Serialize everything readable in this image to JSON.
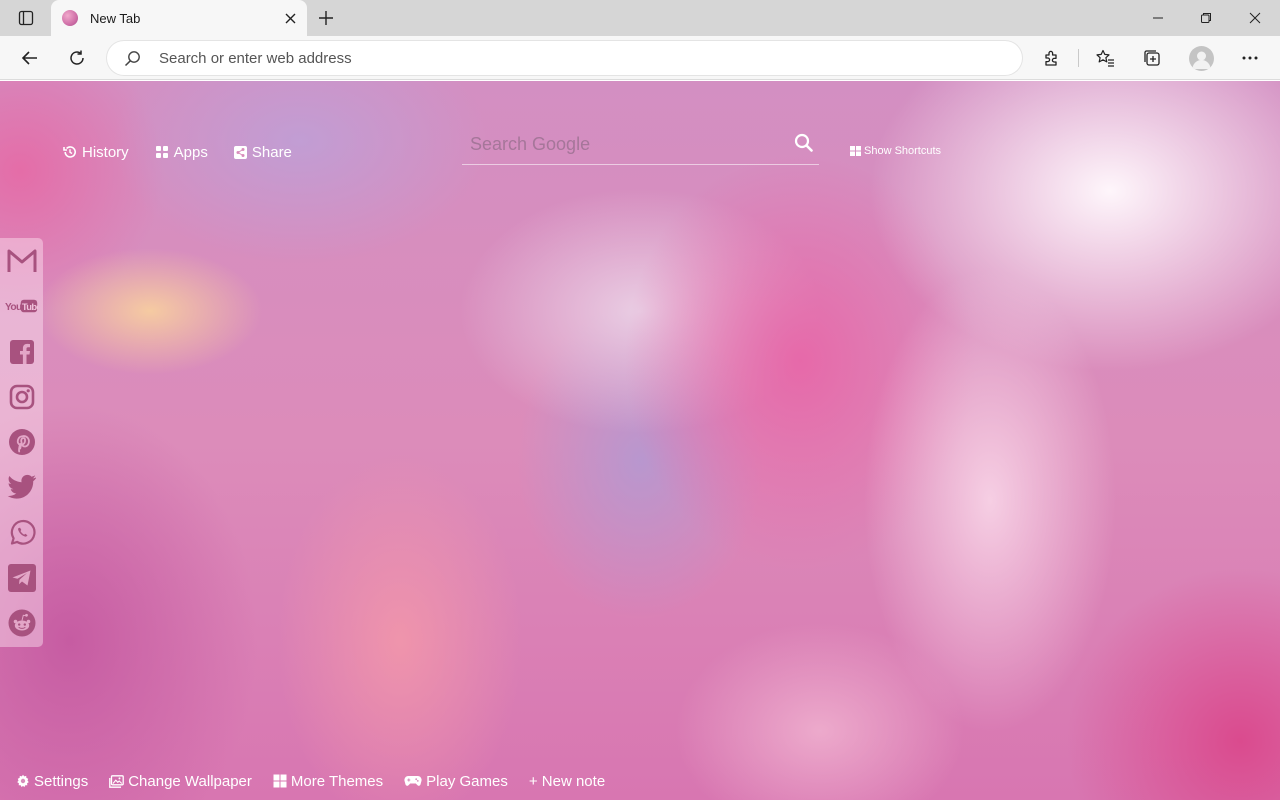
{
  "browser": {
    "tab": {
      "title": "New Tab"
    },
    "address_bar": {
      "placeholder": "Search or enter web address",
      "value": ""
    }
  },
  "page": {
    "top_links": [
      {
        "label": "History",
        "icon": "history-icon"
      },
      {
        "label": "Apps",
        "icon": "apps-grid-icon"
      },
      {
        "label": "Share",
        "icon": "share-icon"
      }
    ],
    "search": {
      "placeholder": "Search Google"
    },
    "shortcuts_toggle": {
      "label": "Show Shortcuts"
    },
    "social_links": [
      {
        "name": "Gmail",
        "icon": "gmail-icon"
      },
      {
        "name": "YouTube",
        "icon": "youtube-icon",
        "wordmark": "YouTube"
      },
      {
        "name": "Facebook",
        "icon": "facebook-icon"
      },
      {
        "name": "Instagram",
        "icon": "instagram-icon"
      },
      {
        "name": "Pinterest",
        "icon": "pinterest-icon"
      },
      {
        "name": "Twitter",
        "icon": "twitter-icon"
      },
      {
        "name": "WhatsApp",
        "icon": "whatsapp-icon"
      },
      {
        "name": "Telegram",
        "icon": "telegram-icon"
      },
      {
        "name": "Reddit",
        "icon": "reddit-icon"
      }
    ],
    "bottom_bar": [
      {
        "label": "Settings",
        "icon": "gear-icon"
      },
      {
        "label": "Change Wallpaper",
        "icon": "image-icon"
      },
      {
        "label": "More Themes",
        "icon": "grid-icon"
      },
      {
        "label": "Play Games",
        "icon": "gamepad-icon"
      },
      {
        "label": "+ New note",
        "icon": ""
      }
    ]
  },
  "colors": {
    "chrome_tabbar": "#d6d6d6",
    "chrome_toolbar": "#f7f7f7",
    "social_icon": "#a8527f",
    "wallpaper_base": "#d987b6"
  }
}
